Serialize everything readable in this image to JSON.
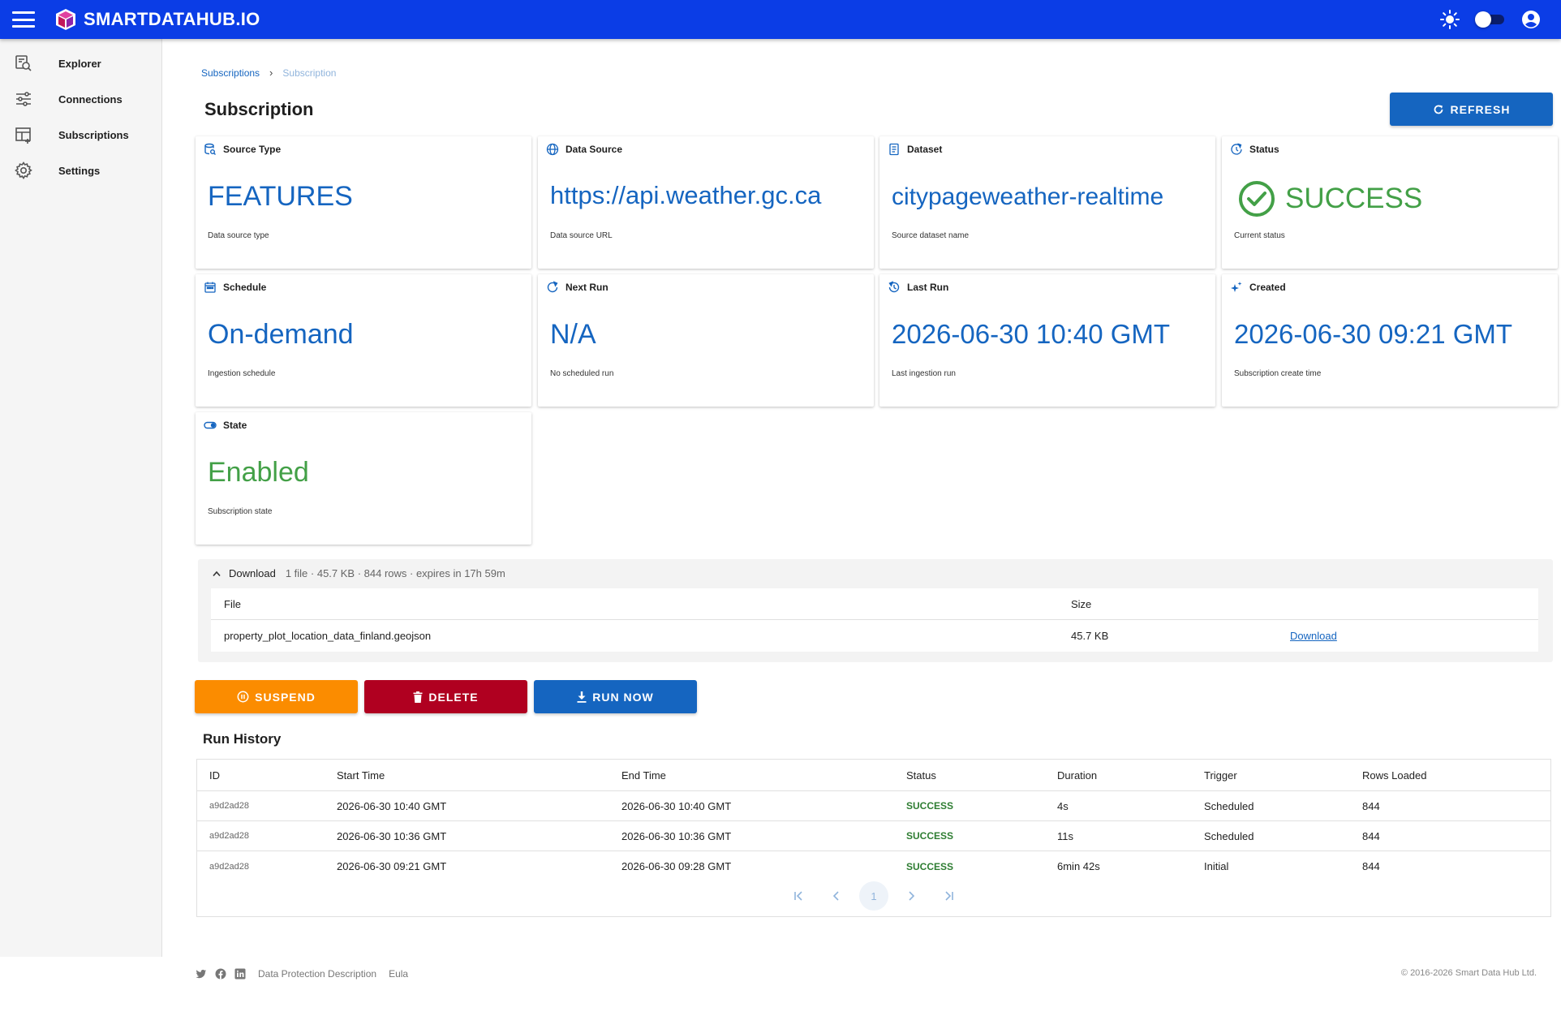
{
  "app": {
    "title": "SMARTDATAHUB.IO"
  },
  "sidebar": {
    "items": [
      {
        "label": "Explorer",
        "icon": "explorer-search-icon"
      },
      {
        "label": "Connections",
        "icon": "connections-icon"
      },
      {
        "label": "Subscriptions",
        "icon": "subscriptions-icon"
      },
      {
        "label": "Settings",
        "icon": "gear-icon"
      }
    ]
  },
  "breadcrumb": {
    "parent": "Subscriptions",
    "current": "Subscription"
  },
  "page": {
    "title": "Subscription",
    "refresh_label": "REFRESH"
  },
  "cards": {
    "source_type": {
      "title": "Source Type",
      "value": "FEATURES",
      "sub": "Data source type"
    },
    "data_source": {
      "title": "Data Source",
      "value": "https://api.weather.gc.ca",
      "sub": "Data source URL"
    },
    "dataset": {
      "title": "Dataset",
      "value": "citypageweather-realtime",
      "sub": "Source dataset name"
    },
    "status": {
      "title": "Status",
      "value": "SUCCESS",
      "sub": "Current status"
    },
    "schedule": {
      "title": "Schedule",
      "value": "On-demand",
      "sub": "Ingestion schedule"
    },
    "next_run": {
      "title": "Next Run",
      "value": "N/A",
      "sub": "No scheduled run"
    },
    "last_run": {
      "title": "Last Run",
      "value": "2026-06-30 10:40 GMT",
      "sub": "Last ingestion run"
    },
    "created": {
      "title": "Created",
      "value": "2026-06-30 09:21 GMT",
      "sub": "Subscription create time"
    },
    "state": {
      "title": "State",
      "value": "Enabled",
      "sub": "Subscription state"
    }
  },
  "download": {
    "title": "Download",
    "meta": "1 file · 45.7 KB · 844 rows · expires in 17h 59m",
    "col_file": "File",
    "col_size": "Size",
    "file_name": "property_plot_location_data_finland.geojson",
    "file_size": "45.7 KB",
    "link_label": "Download"
  },
  "actions": {
    "suspend": "SUSPEND",
    "delete": "DELETE",
    "run_now": "RUN NOW"
  },
  "run_history": {
    "title": "Run History",
    "columns": [
      "ID",
      "Start Time",
      "End Time",
      "Status",
      "Duration",
      "Trigger",
      "Rows Loaded"
    ],
    "rows": [
      {
        "id": "a9d2ad28",
        "start": "2026-06-30 10:40 GMT",
        "end": "2026-06-30 10:40 GMT",
        "status": "SUCCESS",
        "duration": "4s",
        "trigger": "Scheduled",
        "rows": "844"
      },
      {
        "id": "a9d2ad28",
        "start": "2026-06-30 10:36 GMT",
        "end": "2026-06-30 10:36 GMT",
        "status": "SUCCESS",
        "duration": "11s",
        "trigger": "Scheduled",
        "rows": "844"
      },
      {
        "id": "a9d2ad28",
        "start": "2026-06-30 09:21 GMT",
        "end": "2026-06-30 09:28 GMT",
        "status": "SUCCESS",
        "duration": "6min 42s",
        "trigger": "Initial",
        "rows": "844"
      }
    ],
    "pager": {
      "page": "1"
    }
  },
  "footer": {
    "links": [
      "Data Protection Description",
      "Eula"
    ],
    "copyright": "© 2016-2026 Smart Data Hub Ltd."
  },
  "colors": {
    "brand": "#0b3de6",
    "accent": "#1565c0",
    "success": "#43a047",
    "warning": "#fb8c00",
    "danger": "#b00020"
  }
}
